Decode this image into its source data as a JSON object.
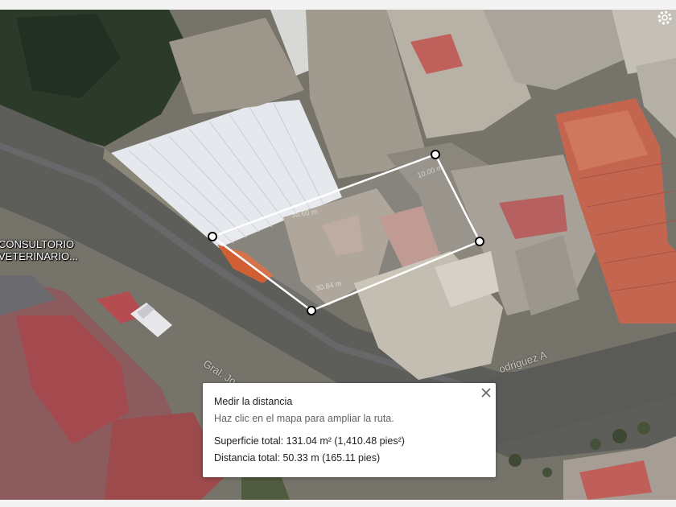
{
  "map": {
    "labels": {
      "business_line1": "CONSULTORIO",
      "business_line2": "VETERINARIO...",
      "street_left": "Gral. Jo",
      "street_right": "odriguez A"
    },
    "segment_labels": [
      "35.60 m",
      "30.84 m",
      "10.00 m"
    ],
    "measure_color": "#ffffff",
    "icons": [
      "gear-icon",
      "close-icon",
      "measure-point-icon"
    ]
  },
  "measure_card": {
    "title": "Medir la distancia",
    "hint": "Haz clic en el mapa para ampliar la ruta.",
    "area": "Superficie total: 131.04 m² (1,410.48 pies²)",
    "distance": "Distancia total: 50.33 m (165.11 pies)"
  }
}
